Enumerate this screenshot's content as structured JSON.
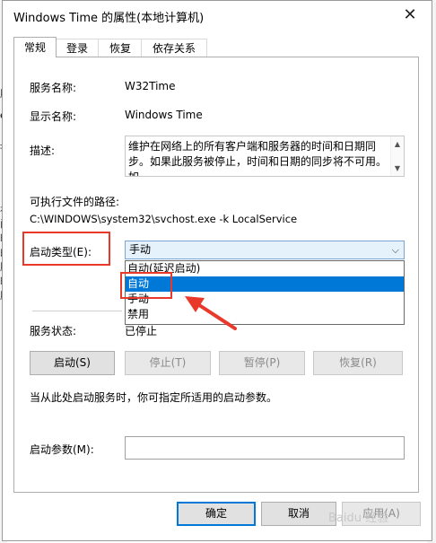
{
  "background": {
    "fragments": [
      "服",
      "d",
      "‡",
      "在",
      "间",
      "时",
      "的",
      "服",
      "时",
      "服"
    ]
  },
  "dialog": {
    "title": "Windows Time 的属性(本地计算机)",
    "close_icon": "close-icon"
  },
  "tabs": [
    {
      "label": "常规",
      "active": true
    },
    {
      "label": "登录",
      "active": false
    },
    {
      "label": "恢复",
      "active": false
    },
    {
      "label": "依存关系",
      "active": false
    }
  ],
  "general": {
    "service_name_label": "服务名称:",
    "service_name_value": "W32Time",
    "display_name_label": "显示名称:",
    "display_name_value": "Windows Time",
    "description_label": "描述:",
    "description_text": "维护在网络上的所有客户端和服务器的时间和日期同步。如果此服务被停止，时间和日期的同步将不可用。如",
    "exe_path_label": "可执行文件的路径:",
    "exe_path_value": "C:\\WINDOWS\\system32\\svchost.exe -k LocalService",
    "startup_type_label": "启动类型(E):",
    "startup_type_value": "手动",
    "startup_options": [
      "自动(延迟启动)",
      "自动",
      "手动",
      "禁用"
    ],
    "startup_selected_index": 1,
    "service_status_label": "服务状态:",
    "service_status_value": "已停止",
    "hint_text": "当从此处启动服务时，你可指定所适用的启动参数。",
    "start_params_label": "启动参数(M):",
    "start_params_value": ""
  },
  "service_buttons": {
    "start": "启动(S)",
    "stop": "停止(T)",
    "pause": "暂停(P)",
    "resume": "恢复(R)"
  },
  "footer_buttons": {
    "ok": "确定",
    "cancel": "取消",
    "apply": "应用(A)"
  },
  "colors": {
    "accent": "#0078d7",
    "annotation": "#e8392b"
  },
  "watermark": "Baidu 经验"
}
